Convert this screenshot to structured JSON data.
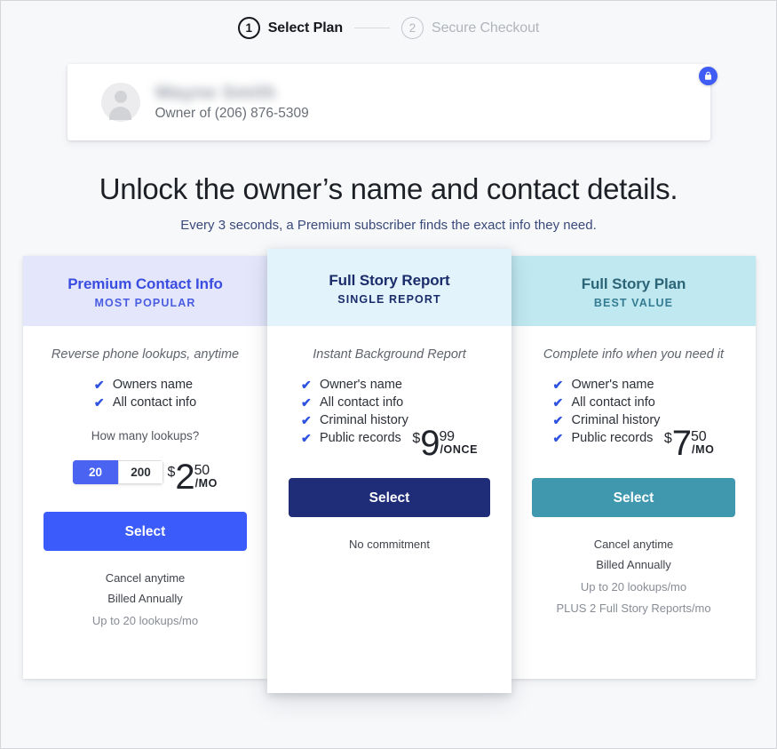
{
  "stepper": {
    "steps": [
      {
        "number": "1",
        "label": "Select Plan",
        "active": true
      },
      {
        "number": "2",
        "label": "Secure Checkout",
        "active": false
      }
    ]
  },
  "owner_card": {
    "name_blurred": "Wayne Smith",
    "subtitle": "Owner of (206) 876-5309",
    "lock_icon": "lock-icon",
    "avatar_icon": "person-avatar-icon"
  },
  "headline": "Unlock the owner’s name and contact details.",
  "subhead": "Every 3 seconds, a Premium subscriber finds the exact info they need.",
  "plans": [
    {
      "title": "Premium Contact Info",
      "badge": "MOST POPULAR",
      "tagline": "Reverse phone lookups, anytime",
      "features": [
        "Owners name",
        "All contact info"
      ],
      "lookups_question": "How many lookups?",
      "lookups_options": [
        {
          "label": "20",
          "selected": true
        },
        {
          "label": "200",
          "selected": false
        }
      ],
      "price": {
        "dollar": "$",
        "whole": "2",
        "cents": "50",
        "per": "/MO"
      },
      "button_label": "Select",
      "button_color": "#3b5bfa",
      "header_color": "#e4e7fb",
      "footnotes": [
        "Cancel anytime",
        "Billed Annually"
      ],
      "footnotes_muted": [
        "Up to 20 lookups/mo"
      ]
    },
    {
      "title": "Full Story Report",
      "badge": "SINGLE REPORT",
      "tagline": "Instant Background Report",
      "features": [
        "Owner's name",
        "All contact info",
        "Criminal history",
        "Public records"
      ],
      "price": {
        "dollar": "$",
        "whole": "9",
        "cents": "99",
        "per": "/ONCE"
      },
      "button_label": "Select",
      "button_color": "#1f2d78",
      "header_color": "#e2f3fc",
      "footnotes": [
        "No commitment"
      ],
      "footnotes_muted": []
    },
    {
      "title": "Full Story Plan",
      "badge": "BEST VALUE",
      "tagline": "Complete info when you need it",
      "features": [
        "Owner's name",
        "All contact info",
        "Criminal history",
        "Public records"
      ],
      "price": {
        "dollar": "$",
        "whole": "7",
        "cents": "50",
        "per": "/MO"
      },
      "button_label": "Select",
      "button_color": "#3f98ae",
      "header_color": "#bfe8f0",
      "footnotes": [
        "Cancel anytime",
        "Billed Annually"
      ],
      "footnotes_muted": [
        "Up to 20 lookups/mo",
        "PLUS 2 Full Story Reports/mo"
      ]
    }
  ],
  "icons": {
    "check": "✔"
  }
}
